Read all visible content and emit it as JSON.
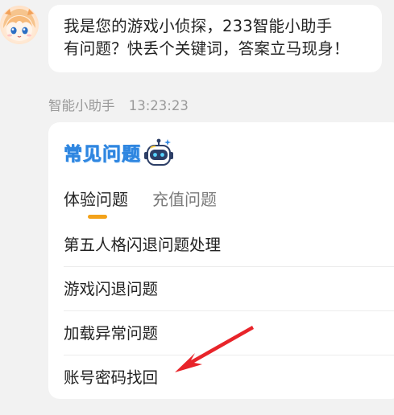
{
  "bot_message": {
    "line1": "我是您的游戏小侦探，233智能小助手",
    "line2": "有问题？快丢个关键词，答案立马现身！"
  },
  "sender": {
    "name": "智能小助手",
    "time": "13:23:23"
  },
  "faq_card": {
    "title": "常见问题",
    "title_icon": "robot-icon",
    "accent_color": "#f3a21a",
    "tabs": [
      {
        "label": "体验问题",
        "active": true
      },
      {
        "label": "充值问题",
        "active": false
      }
    ],
    "questions": [
      "第五人格闪退问题处理",
      "游戏闪退问题",
      "加载异常问题",
      "账号密码找回"
    ]
  },
  "annotation": {
    "arrow_color": "#e8242a",
    "arrow_icon": "red-arrow-icon"
  }
}
